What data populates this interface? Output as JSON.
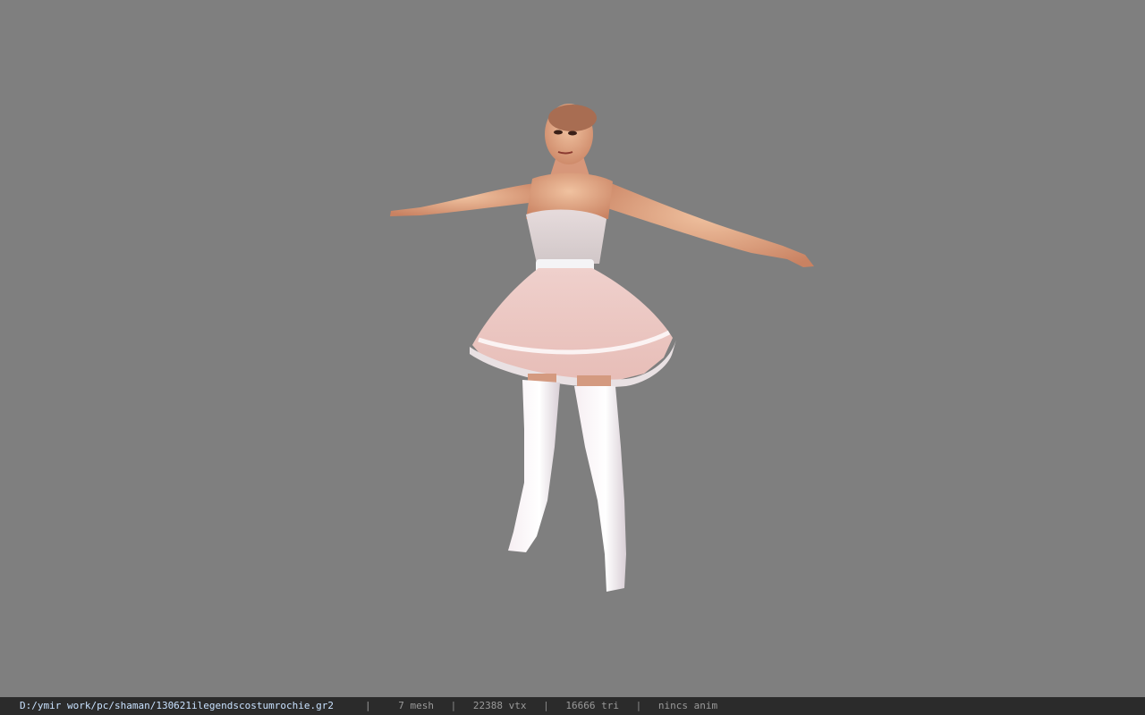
{
  "status_bar": {
    "file_path": "D:/ymir work/pc/shaman/130621ilegendscostumrochie.gr2",
    "separator": "|",
    "mesh": "7 mesh",
    "vtx": "22388 vtx",
    "tri": "16666 tri",
    "anim": "nincs anim"
  },
  "colors": {
    "viewport_bg": "#7f7f7f",
    "status_bg": "#2b2b2b",
    "path_text": "#c9e2ff",
    "stats_text": "#9a9a9a"
  }
}
